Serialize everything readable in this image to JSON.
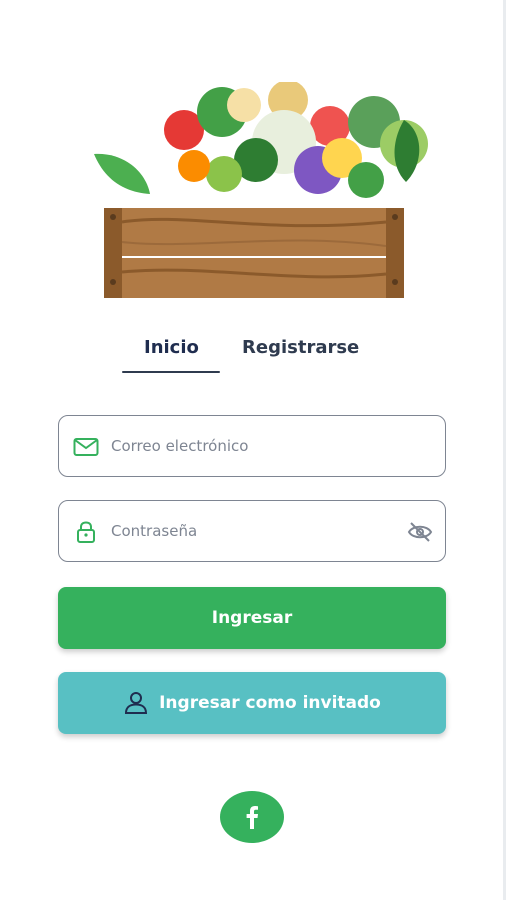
{
  "tabs": {
    "login": "Inicio",
    "register": "Registrarse"
  },
  "form": {
    "email_placeholder": "Correo electrónico",
    "password_placeholder": "Contraseña"
  },
  "buttons": {
    "login": "Ingresar",
    "guest": "Ingresar como invitado"
  },
  "icons": {
    "email": "mail-icon",
    "password": "lock-icon",
    "toggle": "eye-off-icon",
    "guest": "user-icon",
    "social": "facebook-icon"
  },
  "colors": {
    "primary": "#35b15d",
    "secondary": "#58c0c3",
    "text_dark": "#1f2d4f",
    "text_muted": "#7e8592",
    "border": "#7e8592"
  }
}
